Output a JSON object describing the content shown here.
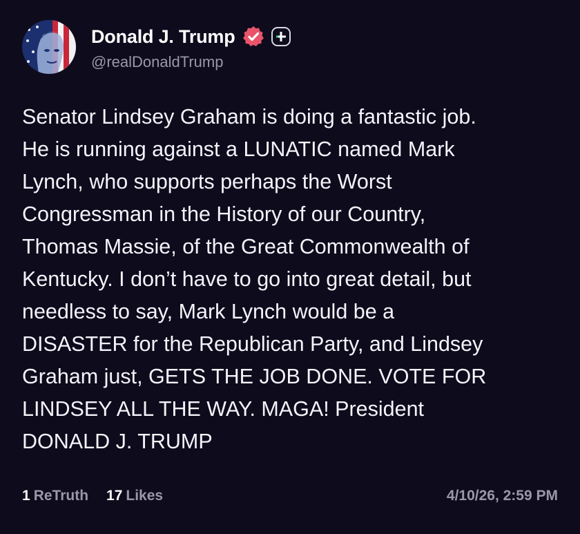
{
  "post": {
    "author": {
      "display_name": "Donald J. Trump",
      "handle": "@realDonaldTrump",
      "verified_icon": "verified-badge-icon",
      "follow_icon": "add-follow-icon"
    },
    "body": "Senator Lindsey Graham is doing a fantastic job.\nHe is running against a LUNATIC named Mark\nLynch, who supports perhaps the Worst\nCongressman in the History of our Country,\nThomas Massie, of the Great Commonwealth of\nKentucky. I don’t have to go into great detail, but\nneedless to say, Mark Lynch would be a\nDISASTER for the Republican Party, and Lindsey\nGraham just, GETS THE JOB DONE. VOTE FOR\nLINDSEY ALL THE WAY. MAGA! President\nDONALD J. TRUMP",
    "stats": {
      "retruth_count": "1",
      "retruth_label": "ReTruth",
      "likes_count": "17",
      "likes_label": "Likes"
    },
    "timestamp": "4/10/26, 2:59 PM"
  },
  "colors": {
    "background": "#0e0b1d",
    "text_primary": "#f4f3f8",
    "text_secondary": "#9a98a8",
    "verified_badge": "#e9546b"
  }
}
